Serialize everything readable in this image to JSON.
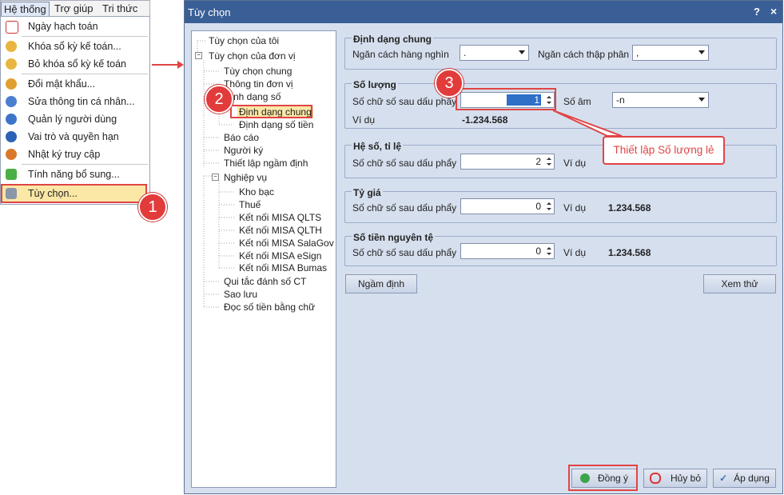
{
  "menubar": {
    "items": [
      "Hệ thống",
      "Trợ giúp",
      "Tri thức"
    ]
  },
  "menu": {
    "items": [
      {
        "label": "Ngày hạch toán",
        "icon": "calendar-icon"
      },
      {
        "label": "Khóa sổ kỳ kế toán...",
        "icon": "lock-icon"
      },
      {
        "label": "Bỏ khóa sổ kỳ kế toán",
        "icon": "unlock-icon"
      },
      {
        "label": "Đổi mật khẩu...",
        "icon": "key-icon"
      },
      {
        "label": "Sửa thông tin cá nhân...",
        "icon": "user-edit-icon"
      },
      {
        "label": "Quản lý người dùng",
        "icon": "users-icon"
      },
      {
        "label": "Vai trò và quyền hạn",
        "icon": "role-icon"
      },
      {
        "label": "Nhật ký truy cập",
        "icon": "log-icon"
      },
      {
        "label": "Tính năng bổ sung...",
        "icon": "puzzle-icon"
      },
      {
        "label": "Tùy chọn...",
        "icon": "tools-icon"
      }
    ]
  },
  "dialog": {
    "title": "Tùy chọn",
    "help": "?",
    "close": "×",
    "tree": [
      "Tùy chọn của tôi",
      "Tùy chọn của đơn vị",
      "Tùy chọn chung",
      "Thông tin đơn vị",
      "nh dạng số",
      "Định dạng chung",
      "Định dạng số tiền",
      "Báo cáo",
      "Người ký",
      "Thiết lập ngầm định",
      "Nghiệp vụ",
      "Kho bạc",
      "Thuế",
      "Kết nối MISA QLTS",
      "Kết nối MISA QLTH",
      "Kết nối MISA SalaGov",
      "Kết nối MISA eSign",
      "Kết nối MISA Bumas",
      "Qui tắc đánh số CT",
      "Sao lưu",
      "Đọc số tiền bằng chữ"
    ],
    "general": {
      "title": "Định dạng chung",
      "thousand_label": "Ngăn cách hàng nghìn",
      "thousand_value": ".",
      "decimal_label": "Ngăn cách thập phân",
      "decimal_value": ","
    },
    "quantity": {
      "title": "Số lượng",
      "decimals_label": "Số chữ số sau dấu phẩy",
      "decimals_value": "1",
      "negative_label": "Số âm",
      "negative_value": "-n",
      "example_label": "Ví dụ",
      "example_value": "-1.234.568"
    },
    "coefficient": {
      "title": "Hệ số, tỉ lệ",
      "decimals_label": "Số chữ số sau dấu phẩy",
      "decimals_value": "2",
      "example_label": "Ví dụ"
    },
    "rate": {
      "title": "Tỷ giá",
      "decimals_label": "Số chữ số sau dấu phẩy",
      "decimals_value": "0",
      "example_label": "Ví dụ",
      "example_value": "1.234.568"
    },
    "currency": {
      "title": "Số tiền nguyên tệ",
      "decimals_label": "Số chữ số sau dấu phẩy",
      "decimals_value": "0",
      "example_label": "Ví dụ",
      "example_value": "1.234.568"
    },
    "buttons": {
      "default": "Ngầm định",
      "preview": "Xem thử",
      "ok": "Đồng ý",
      "cancel": "Hủy bỏ",
      "apply": "Áp dụng"
    }
  },
  "annotations": {
    "badge1": "1",
    "badge2": "2",
    "badge3": "3",
    "callout": "Thiết lập Số lượng lẻ"
  },
  "colors": {
    "accent_red": "#e04545",
    "titlebar": "#395f96",
    "dialog_bg": "#d6dfee",
    "selected_highlight": "#fbe7a6"
  }
}
